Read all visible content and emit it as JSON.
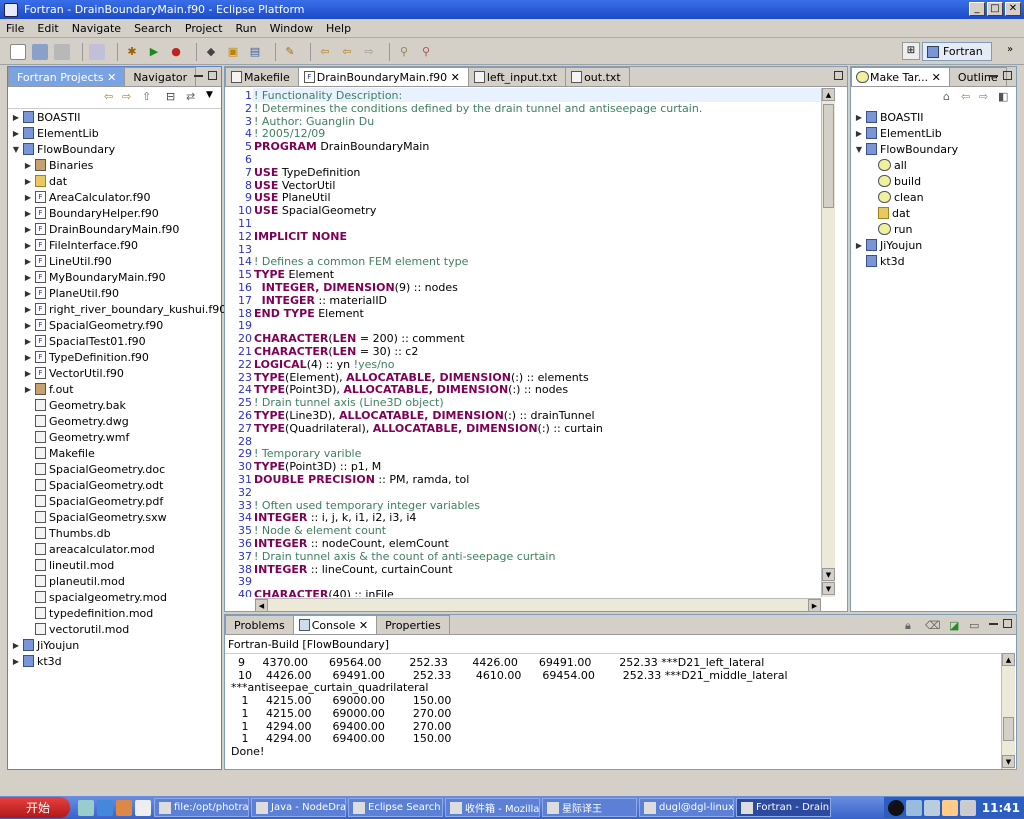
{
  "window": {
    "title": "Fortran - DrainBoundaryMain.f90 - Eclipse Platform"
  },
  "menu": [
    "File",
    "Edit",
    "Navigate",
    "Search",
    "Project",
    "Run",
    "Window",
    "Help"
  ],
  "perspective": {
    "label": "Fortran"
  },
  "left_panel": {
    "tabs": [
      {
        "label": "Fortran Projects",
        "active": true
      },
      {
        "label": "Navigator",
        "active": false
      }
    ],
    "tree": [
      {
        "level": 0,
        "twisty": "▶",
        "icon": "proj",
        "label": "BOASTII"
      },
      {
        "level": 0,
        "twisty": "▶",
        "icon": "proj",
        "label": "ElementLib"
      },
      {
        "level": 0,
        "twisty": "▼",
        "icon": "proj",
        "label": "FlowBoundary"
      },
      {
        "level": 1,
        "twisty": "▶",
        "icon": "bin",
        "label": "Binaries"
      },
      {
        "level": 1,
        "twisty": "▶",
        "icon": "folder",
        "label": "dat"
      },
      {
        "level": 1,
        "twisty": "▶",
        "icon": "fortran",
        "label": "AreaCalculator.f90"
      },
      {
        "level": 1,
        "twisty": "▶",
        "icon": "fortran",
        "label": "BoundaryHelper.f90"
      },
      {
        "level": 1,
        "twisty": "▶",
        "icon": "fortran",
        "label": "DrainBoundaryMain.f90"
      },
      {
        "level": 1,
        "twisty": "▶",
        "icon": "fortran",
        "label": "FileInterface.f90"
      },
      {
        "level": 1,
        "twisty": "▶",
        "icon": "fortran",
        "label": "LineUtil.f90"
      },
      {
        "level": 1,
        "twisty": "▶",
        "icon": "fortran",
        "label": "MyBoundaryMain.f90"
      },
      {
        "level": 1,
        "twisty": "▶",
        "icon": "fortran",
        "label": "PlaneUtil.f90"
      },
      {
        "level": 1,
        "twisty": "▶",
        "icon": "fortran",
        "label": "right_river_boundary_kushui.f90"
      },
      {
        "level": 1,
        "twisty": "▶",
        "icon": "fortran",
        "label": "SpacialGeometry.f90"
      },
      {
        "level": 1,
        "twisty": "▶",
        "icon": "fortran",
        "label": "SpacialTest01.f90"
      },
      {
        "level": 1,
        "twisty": "▶",
        "icon": "fortran",
        "label": "TypeDefinition.f90"
      },
      {
        "level": 1,
        "twisty": "▶",
        "icon": "fortran",
        "label": "VectorUtil.f90"
      },
      {
        "level": 1,
        "twisty": "▶",
        "icon": "bin",
        "label": "f.out"
      },
      {
        "level": 1,
        "twisty": "",
        "icon": "doc",
        "label": "Geometry.bak"
      },
      {
        "level": 1,
        "twisty": "",
        "icon": "doc",
        "label": "Geometry.dwg"
      },
      {
        "level": 1,
        "twisty": "",
        "icon": "doc",
        "label": "Geometry.wmf"
      },
      {
        "level": 1,
        "twisty": "",
        "icon": "doc",
        "label": "Makefile"
      },
      {
        "level": 1,
        "twisty": "",
        "icon": "doc",
        "label": "SpacialGeometry.doc"
      },
      {
        "level": 1,
        "twisty": "",
        "icon": "doc",
        "label": "SpacialGeometry.odt"
      },
      {
        "level": 1,
        "twisty": "",
        "icon": "doc",
        "label": "SpacialGeometry.pdf"
      },
      {
        "level": 1,
        "twisty": "",
        "icon": "doc",
        "label": "SpacialGeometry.sxw"
      },
      {
        "level": 1,
        "twisty": "",
        "icon": "doc",
        "label": "Thumbs.db"
      },
      {
        "level": 1,
        "twisty": "",
        "icon": "doc",
        "label": "areacalculator.mod"
      },
      {
        "level": 1,
        "twisty": "",
        "icon": "doc",
        "label": "lineutil.mod"
      },
      {
        "level": 1,
        "twisty": "",
        "icon": "doc",
        "label": "planeutil.mod"
      },
      {
        "level": 1,
        "twisty": "",
        "icon": "doc",
        "label": "spacialgeometry.mod"
      },
      {
        "level": 1,
        "twisty": "",
        "icon": "doc",
        "label": "typedefinition.mod"
      },
      {
        "level": 1,
        "twisty": "",
        "icon": "doc",
        "label": "vectorutil.mod"
      },
      {
        "level": 0,
        "twisty": "▶",
        "icon": "proj",
        "label": "JiYoujun"
      },
      {
        "level": 0,
        "twisty": "▶",
        "icon": "proj",
        "label": "kt3d"
      }
    ]
  },
  "editor": {
    "tabs": [
      {
        "label": "Makefile",
        "active": false
      },
      {
        "label": "DrainBoundaryMain.f90",
        "active": true
      },
      {
        "label": "left_input.txt",
        "active": false
      },
      {
        "label": "out.txt",
        "active": false
      }
    ],
    "lines": [
      {
        "n": "1",
        "parts": [
          {
            "t": "! Functionality Description:",
            "c": "cm"
          }
        ]
      },
      {
        "n": "2",
        "parts": [
          {
            "t": "! Determines the conditions defined by the drain tunnel and antiseepage curtain.",
            "c": "cm"
          }
        ]
      },
      {
        "n": "3",
        "parts": [
          {
            "t": "! Author: Guanglin Du",
            "c": "cm"
          }
        ]
      },
      {
        "n": "4",
        "parts": [
          {
            "t": "! 2005/12/09",
            "c": "cm"
          }
        ]
      },
      {
        "n": "5",
        "parts": [
          {
            "t": "PROGRAM",
            "c": "kw"
          },
          {
            "t": " DrainBoundaryMain",
            "c": "normal"
          }
        ]
      },
      {
        "n": "6",
        "parts": []
      },
      {
        "n": "7",
        "parts": [
          {
            "t": "USE",
            "c": "kw"
          },
          {
            "t": " TypeDefinition",
            "c": "normal"
          }
        ]
      },
      {
        "n": "8",
        "parts": [
          {
            "t": "USE",
            "c": "kw"
          },
          {
            "t": " VectorUtil",
            "c": "normal"
          }
        ]
      },
      {
        "n": "9",
        "parts": [
          {
            "t": "USE",
            "c": "kw"
          },
          {
            "t": " PlaneUtil",
            "c": "normal"
          }
        ]
      },
      {
        "n": "10",
        "parts": [
          {
            "t": "USE",
            "c": "kw"
          },
          {
            "t": " SpacialGeometry",
            "c": "normal"
          }
        ]
      },
      {
        "n": "11",
        "parts": []
      },
      {
        "n": "12",
        "parts": [
          {
            "t": "IMPLICIT NONE",
            "c": "kw"
          }
        ]
      },
      {
        "n": "13",
        "parts": []
      },
      {
        "n": "14",
        "parts": [
          {
            "t": "! Defines a common FEM element type",
            "c": "cm"
          }
        ]
      },
      {
        "n": "15",
        "parts": [
          {
            "t": "TYPE",
            "c": "kw"
          },
          {
            "t": " Element",
            "c": "normal"
          }
        ]
      },
      {
        "n": "16",
        "parts": [
          {
            "t": "  INTEGER, DIMENSION",
            "c": "kw"
          },
          {
            "t": "(9) :: nodes",
            "c": "normal"
          }
        ]
      },
      {
        "n": "17",
        "parts": [
          {
            "t": "  INTEGER",
            "c": "kw"
          },
          {
            "t": " :: materialID",
            "c": "normal"
          }
        ]
      },
      {
        "n": "18",
        "parts": [
          {
            "t": "END TYPE",
            "c": "kw"
          },
          {
            "t": " Element",
            "c": "normal"
          }
        ]
      },
      {
        "n": "19",
        "parts": []
      },
      {
        "n": "20",
        "parts": [
          {
            "t": "CHARACTER",
            "c": "kw"
          },
          {
            "t": "(",
            "c": "normal"
          },
          {
            "t": "LEN",
            "c": "kw"
          },
          {
            "t": " = 200) :: comment",
            "c": "normal"
          }
        ]
      },
      {
        "n": "21",
        "parts": [
          {
            "t": "CHARACTER",
            "c": "kw"
          },
          {
            "t": "(",
            "c": "normal"
          },
          {
            "t": "LEN",
            "c": "kw"
          },
          {
            "t": " = 30) :: c2",
            "c": "normal"
          }
        ]
      },
      {
        "n": "22",
        "parts": [
          {
            "t": "LOGICAL",
            "c": "kw"
          },
          {
            "t": "(4) :: yn ",
            "c": "normal"
          },
          {
            "t": "!yes/no",
            "c": "cm"
          }
        ]
      },
      {
        "n": "23",
        "parts": [
          {
            "t": "TYPE",
            "c": "kw"
          },
          {
            "t": "(Element), ",
            "c": "normal"
          },
          {
            "t": "ALLOCATABLE, DIMENSION",
            "c": "kw"
          },
          {
            "t": "(:) :: elements",
            "c": "normal"
          }
        ]
      },
      {
        "n": "24",
        "parts": [
          {
            "t": "TYPE",
            "c": "kw"
          },
          {
            "t": "(Point3D), ",
            "c": "normal"
          },
          {
            "t": "ALLOCATABLE, DIMENSION",
            "c": "kw"
          },
          {
            "t": "(:) :: nodes",
            "c": "normal"
          }
        ]
      },
      {
        "n": "25",
        "parts": [
          {
            "t": "! Drain tunnel axis (Line3D object)",
            "c": "cm"
          }
        ]
      },
      {
        "n": "26",
        "parts": [
          {
            "t": "TYPE",
            "c": "kw"
          },
          {
            "t": "(Line3D), ",
            "c": "normal"
          },
          {
            "t": "ALLOCATABLE, DIMENSION",
            "c": "kw"
          },
          {
            "t": "(:) :: drainTunnel",
            "c": "normal"
          }
        ]
      },
      {
        "n": "27",
        "parts": [
          {
            "t": "TYPE",
            "c": "kw"
          },
          {
            "t": "(Quadrilateral), ",
            "c": "normal"
          },
          {
            "t": "ALLOCATABLE, DIMENSION",
            "c": "kw"
          },
          {
            "t": "(:) :: curtain",
            "c": "normal"
          }
        ]
      },
      {
        "n": "28",
        "parts": []
      },
      {
        "n": "29",
        "parts": [
          {
            "t": "! Temporary varible",
            "c": "cm"
          }
        ]
      },
      {
        "n": "30",
        "parts": [
          {
            "t": "TYPE",
            "c": "kw"
          },
          {
            "t": "(Point3D) :: p1, M",
            "c": "normal"
          }
        ]
      },
      {
        "n": "31",
        "parts": [
          {
            "t": "DOUBLE PRECISION",
            "c": "kw"
          },
          {
            "t": " :: PM, ramda, tol",
            "c": "normal"
          }
        ]
      },
      {
        "n": "32",
        "parts": []
      },
      {
        "n": "33",
        "parts": [
          {
            "t": "! Often used temporary integer variables",
            "c": "cm"
          }
        ]
      },
      {
        "n": "34",
        "parts": [
          {
            "t": "INTEGER",
            "c": "kw"
          },
          {
            "t": " :: i, j, k, i1, i2, i3, i4",
            "c": "normal"
          }
        ]
      },
      {
        "n": "35",
        "parts": [
          {
            "t": "! Node & element count",
            "c": "cm"
          }
        ]
      },
      {
        "n": "36",
        "parts": [
          {
            "t": "INTEGER",
            "c": "kw"
          },
          {
            "t": " :: nodeCount, elemCount",
            "c": "normal"
          }
        ]
      },
      {
        "n": "37",
        "parts": [
          {
            "t": "! Drain tunnel axis & the count of anti-seepage curtain",
            "c": "cm"
          }
        ]
      },
      {
        "n": "38",
        "parts": [
          {
            "t": "INTEGER",
            "c": "kw"
          },
          {
            "t": " :: lineCount, curtainCount",
            "c": "normal"
          }
        ]
      },
      {
        "n": "39",
        "parts": []
      },
      {
        "n": "40",
        "parts": [
          {
            "t": "CHARACTER",
            "c": "kw"
          },
          {
            "t": "(40) :: inFile",
            "c": "normal"
          }
        ]
      }
    ]
  },
  "right_panel": {
    "tabs": [
      {
        "label": "Make Tar...",
        "active": true
      },
      {
        "label": "Outline",
        "active": false
      }
    ],
    "tree": [
      {
        "level": 0,
        "twisty": "▶",
        "icon": "proj",
        "label": "BOASTII"
      },
      {
        "level": 0,
        "twisty": "▶",
        "icon": "proj",
        "label": "ElementLib"
      },
      {
        "level": 0,
        "twisty": "▼",
        "icon": "proj",
        "label": "FlowBoundary"
      },
      {
        "level": 1,
        "twisty": "",
        "icon": "target",
        "label": "all"
      },
      {
        "level": 1,
        "twisty": "",
        "icon": "target",
        "label": "build"
      },
      {
        "level": 1,
        "twisty": "",
        "icon": "target",
        "label": "clean"
      },
      {
        "level": 1,
        "twisty": "",
        "icon": "folder",
        "label": "dat"
      },
      {
        "level": 1,
        "twisty": "",
        "icon": "target",
        "label": "run"
      },
      {
        "level": 0,
        "twisty": "▶",
        "icon": "proj",
        "label": "JiYoujun"
      },
      {
        "level": 0,
        "twisty": "",
        "icon": "proj",
        "label": "kt3d"
      }
    ]
  },
  "bottom_panel": {
    "tabs": [
      {
        "label": "Problems",
        "active": false
      },
      {
        "label": "Console",
        "active": true
      },
      {
        "label": "Properties",
        "active": false
      }
    ],
    "console_title": "Fortran-Build [FlowBoundary]",
    "lines": [
      "  9     4370.00      69564.00        252.33       4426.00      69491.00        252.33 ***D21_left_lateral",
      "  10    4426.00      69491.00        252.33       4610.00      69454.00        252.33 ***D21_middle_lateral",
      "***antiseepae_curtain_quadrilateral",
      "   1     4215.00      69000.00        150.00",
      "   1     4215.00      69000.00        270.00",
      "   1     4294.00      69400.00        270.00",
      "   1     4294.00      69400.00        150.00",
      "Done!"
    ]
  },
  "taskbar": {
    "start_label": "开始",
    "tasks": [
      {
        "label": "file:/opt/photran-",
        "active": false
      },
      {
        "label": "Java - NodeDra",
        "active": false
      },
      {
        "label": "Eclipse Search",
        "active": false
      },
      {
        "label": "收件箱 - Mozilla",
        "active": false
      },
      {
        "label": "星际译王",
        "active": false
      },
      {
        "label": "dugl@dgl-linux:/",
        "active": false
      },
      {
        "label": "Fortran - Drain",
        "active": true
      }
    ],
    "clock": "11:41"
  }
}
